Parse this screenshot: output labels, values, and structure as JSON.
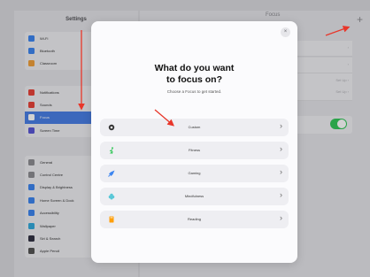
{
  "sidebar": {
    "title": "Settings",
    "group1": [
      {
        "label": "Wi-Fi",
        "color": "#3d86f0"
      },
      {
        "label": "Bluetooth",
        "color": "#3d86f0"
      },
      {
        "label": "Classroom",
        "color": "#f0a03c"
      }
    ],
    "group2": [
      {
        "label": "Notifications",
        "color": "#e8443a"
      },
      {
        "label": "Sounds",
        "color": "#e8443a"
      },
      {
        "label": "Focus",
        "color": "#5a57d6"
      },
      {
        "label": "Screen Time",
        "color": "#5a57d6"
      }
    ],
    "group3": [
      {
        "label": "General",
        "color": "#8e8e93"
      },
      {
        "label": "Control Centre",
        "color": "#8e8e93"
      },
      {
        "label": "Display & Brightness",
        "color": "#3d86f0"
      },
      {
        "label": "Home Screen & Dock",
        "color": "#3d86f0"
      },
      {
        "label": "Accessibility",
        "color": "#3d86f0"
      },
      {
        "label": "Wallpaper",
        "color": "#34aadc"
      },
      {
        "label": "Siri & Search",
        "color": "#333344"
      },
      {
        "label": "Apple Pencil",
        "color": "#555555"
      }
    ]
  },
  "detail": {
    "title": "Focus",
    "rows": [
      {
        "value": "›"
      },
      {
        "value": "›"
      },
      {
        "value": "Set Up ›"
      },
      {
        "value": "Set Up ›"
      }
    ],
    "toggle_on": true
  },
  "modal": {
    "close_label": "×",
    "title_line1": "What do you want",
    "title_line2": "to focus on?",
    "subtitle": "Choose a Focus to get started.",
    "options": [
      {
        "label": "Custom",
        "icon": "custom-icon",
        "color": "#333333"
      },
      {
        "label": "Fitness",
        "icon": "running-icon",
        "color": "#34c759"
      },
      {
        "label": "Gaming",
        "icon": "rocket-icon",
        "color": "#3d86f0"
      },
      {
        "label": "Mindfulness",
        "icon": "flower-icon",
        "color": "#5ac8d8"
      },
      {
        "label": "Reading",
        "icon": "book-icon",
        "color": "#ff9f0a"
      }
    ],
    "chevron": "›"
  },
  "toolbar": {
    "plus_label": "+"
  },
  "colors": {
    "annotation_red": "#e8362a",
    "accent": "#4a7fe6"
  }
}
